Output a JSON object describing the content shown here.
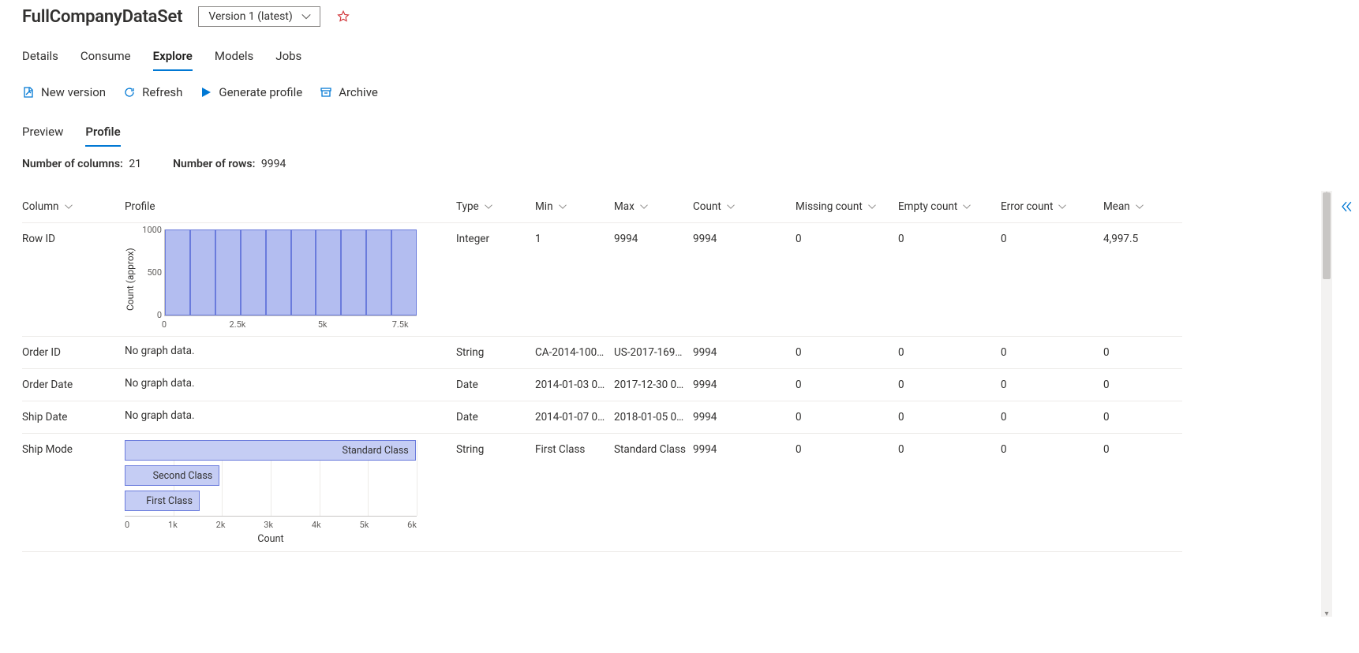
{
  "header": {
    "title": "FullCompanyDataSet",
    "version_label": "Version 1 (latest)"
  },
  "tabs": {
    "items": [
      "Details",
      "Consume",
      "Explore",
      "Models",
      "Jobs"
    ],
    "active": "Explore"
  },
  "commands": {
    "new_version": "New version",
    "refresh": "Refresh",
    "generate_profile": "Generate profile",
    "archive": "Archive"
  },
  "subtabs": {
    "items": [
      "Preview",
      "Profile"
    ],
    "active": "Profile"
  },
  "summary": {
    "cols_label": "Number of columns:",
    "cols_value": "21",
    "rows_label": "Number of rows:",
    "rows_value": "9994"
  },
  "columns": {
    "col": "Column",
    "profile": "Profile",
    "type": "Type",
    "min": "Min",
    "max": "Max",
    "count": "Count",
    "missing": "Missing count",
    "empty": "Empty count",
    "error": "Error count",
    "mean": "Mean"
  },
  "no_graph": "No graph data.",
  "rows": [
    {
      "name": "Row ID",
      "type": "Integer",
      "min": "1",
      "max": "9994",
      "count": "9994",
      "missing": "0",
      "empty": "0",
      "error": "0",
      "mean": "4,997.5",
      "profile": "hist"
    },
    {
      "name": "Order ID",
      "type": "String",
      "min": "CA-2014-100…",
      "max": "US-2017-169…",
      "count": "9994",
      "missing": "0",
      "empty": "0",
      "error": "0",
      "mean": "0",
      "profile": "none"
    },
    {
      "name": "Order Date",
      "type": "Date",
      "min": "2014-01-03 0…",
      "max": "2017-12-30 0…",
      "count": "9994",
      "missing": "0",
      "empty": "0",
      "error": "0",
      "mean": "0",
      "profile": "none"
    },
    {
      "name": "Ship Date",
      "type": "Date",
      "min": "2014-01-07 0…",
      "max": "2018-01-05 0…",
      "count": "9994",
      "missing": "0",
      "empty": "0",
      "error": "0",
      "mean": "0",
      "profile": "none"
    },
    {
      "name": "Ship Mode",
      "type": "String",
      "min": "First Class",
      "max": "Standard Class",
      "count": "9994",
      "missing": "0",
      "empty": "0",
      "error": "0",
      "mean": "0",
      "profile": "hbar"
    }
  ],
  "chart_data": [
    {
      "id": "row-id-hist",
      "type": "bar",
      "ylabel": "Count (approx)",
      "xlabel": "",
      "ylim": [
        0,
        1000
      ],
      "yticks": [
        "1000",
        "500",
        "0"
      ],
      "xticks": [
        "0",
        "2.5k",
        "5k",
        "7.5k"
      ],
      "categories": [
        "0–1k",
        "1k–2k",
        "2k–3k",
        "3k–4k",
        "4k–5k",
        "5k–6k",
        "6k–7k",
        "7k–8k",
        "8k–9k",
        "9k–10k"
      ],
      "values": [
        1000,
        1000,
        1000,
        1000,
        1000,
        1000,
        1000,
        1000,
        1000,
        1000
      ]
    },
    {
      "id": "ship-mode-hbar",
      "type": "bar",
      "orientation": "horizontal",
      "xlabel": "Count",
      "xlim": [
        0,
        6000
      ],
      "xticks": [
        "0",
        "1k",
        "2k",
        "3k",
        "4k",
        "5k",
        "6k"
      ],
      "categories": [
        "Standard Class",
        "Second Class",
        "First Class"
      ],
      "values": [
        5980,
        1950,
        1540
      ]
    }
  ],
  "colors": {
    "accent": "#0078d4",
    "bar_fill": "#b3bdf0",
    "bar_stroke": "#6a7bdc"
  }
}
